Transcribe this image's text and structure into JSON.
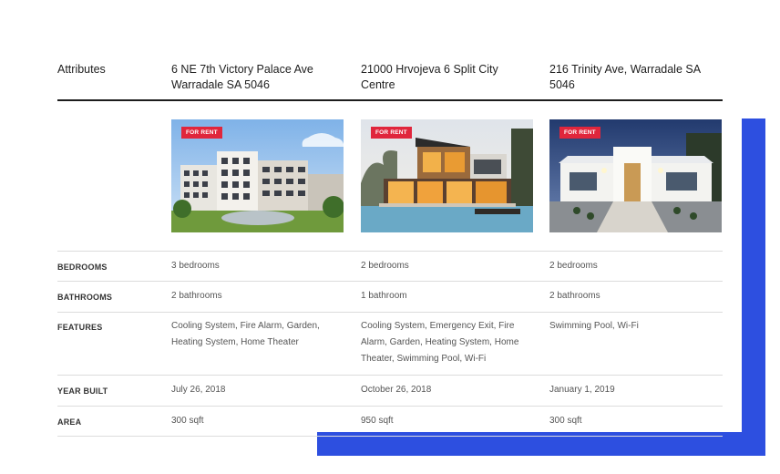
{
  "table": {
    "attributes_label": "Attributes",
    "properties": [
      {
        "address": "6 NE 7th Victory Palace Ave Warradale SA 5046",
        "badge": "FOR RENT",
        "bedrooms": "3 bedrooms",
        "bathrooms": "2 bathrooms",
        "features": "Cooling System, Fire Alarm, Garden, Heating System, Home Theater",
        "year_built": "July 26, 2018",
        "area": "300 sqft"
      },
      {
        "address": "21000 Hrvojeva 6 Split City Centre",
        "badge": "FOR RENT",
        "bedrooms": "2 bedrooms",
        "bathrooms": "1 bathroom",
        "features": "Cooling System, Emergency Exit, Fire Alarm, Garden, Heating System, Home Theater, Swimming Pool, Wi-Fi",
        "year_built": "October 26, 2018",
        "area": "950 sqft"
      },
      {
        "address": "216 Trinity Ave, Warradale SA 5046",
        "badge": "FOR RENT",
        "bedrooms": "2 bedrooms",
        "bathrooms": "2 bathrooms",
        "features": "Swimming Pool, Wi-Fi",
        "year_built": "January 1, 2019",
        "area": "300 sqft"
      }
    ],
    "row_labels": {
      "bedrooms": "BEDROOMS",
      "bathrooms": "BATHROOMS",
      "features": "FEATURES",
      "year_built": "YEAR BUILT",
      "area": "AREA"
    }
  },
  "colors": {
    "accent_blue": "#2d4fe0",
    "badge_red": "#e0263c"
  }
}
